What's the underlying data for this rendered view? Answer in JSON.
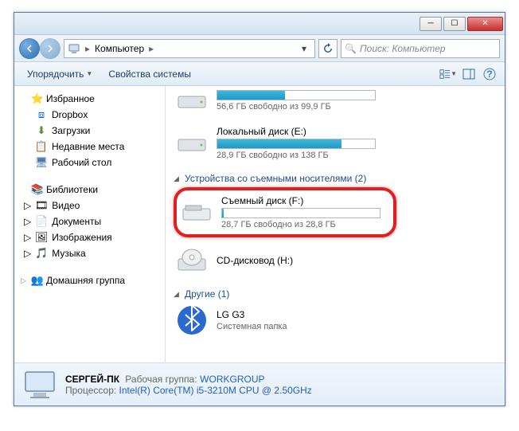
{
  "titlebar": {},
  "address": {
    "location": "Компьютер",
    "search_placeholder": "Поиск: Компьютер"
  },
  "toolbar": {
    "organize": "Упорядочить",
    "properties": "Свойства системы"
  },
  "sidebar": {
    "favorites": {
      "label": "Избранное",
      "items": [
        {
          "icon": "dropbox",
          "label": "Dropbox"
        },
        {
          "icon": "download",
          "label": "Загрузки"
        },
        {
          "icon": "recent",
          "label": "Недавние места"
        },
        {
          "icon": "desktop",
          "label": "Рабочий стол"
        }
      ]
    },
    "libraries": {
      "label": "Библиотеки",
      "items": [
        {
          "icon": "video",
          "label": "Видео"
        },
        {
          "icon": "doc",
          "label": "Документы"
        },
        {
          "icon": "image",
          "label": "Изображения"
        },
        {
          "icon": "music",
          "label": "Музыка"
        }
      ]
    },
    "homegroup": {
      "label": "Домашняя группа"
    }
  },
  "content": {
    "drive_c": {
      "free": "56,6 ГБ свободно из 99,9 ГБ"
    },
    "drive_e": {
      "name": "Локальный диск (E:)",
      "free": "28,9 ГБ свободно из 138 ГБ"
    },
    "removable_header": "Устройства со съемными носителями (2)",
    "drive_f": {
      "name": "Съемный диск (F:)",
      "free": "28,7 ГБ свободно из 28,8 ГБ"
    },
    "cd": {
      "name": "CD-дисковод (H:)"
    },
    "other_header": "Другие (1)",
    "lg": {
      "name": "LG G3",
      "sub": "Системная папка"
    }
  },
  "details": {
    "computer_name": "СЕРГЕЙ-ПК",
    "workgroup_label": "Рабочая группа:",
    "workgroup": "WORKGROUP",
    "cpu_label": "Процессор:",
    "cpu": "Intel(R) Core(TM) i5-3210M CPU @ 2.50GHz"
  }
}
